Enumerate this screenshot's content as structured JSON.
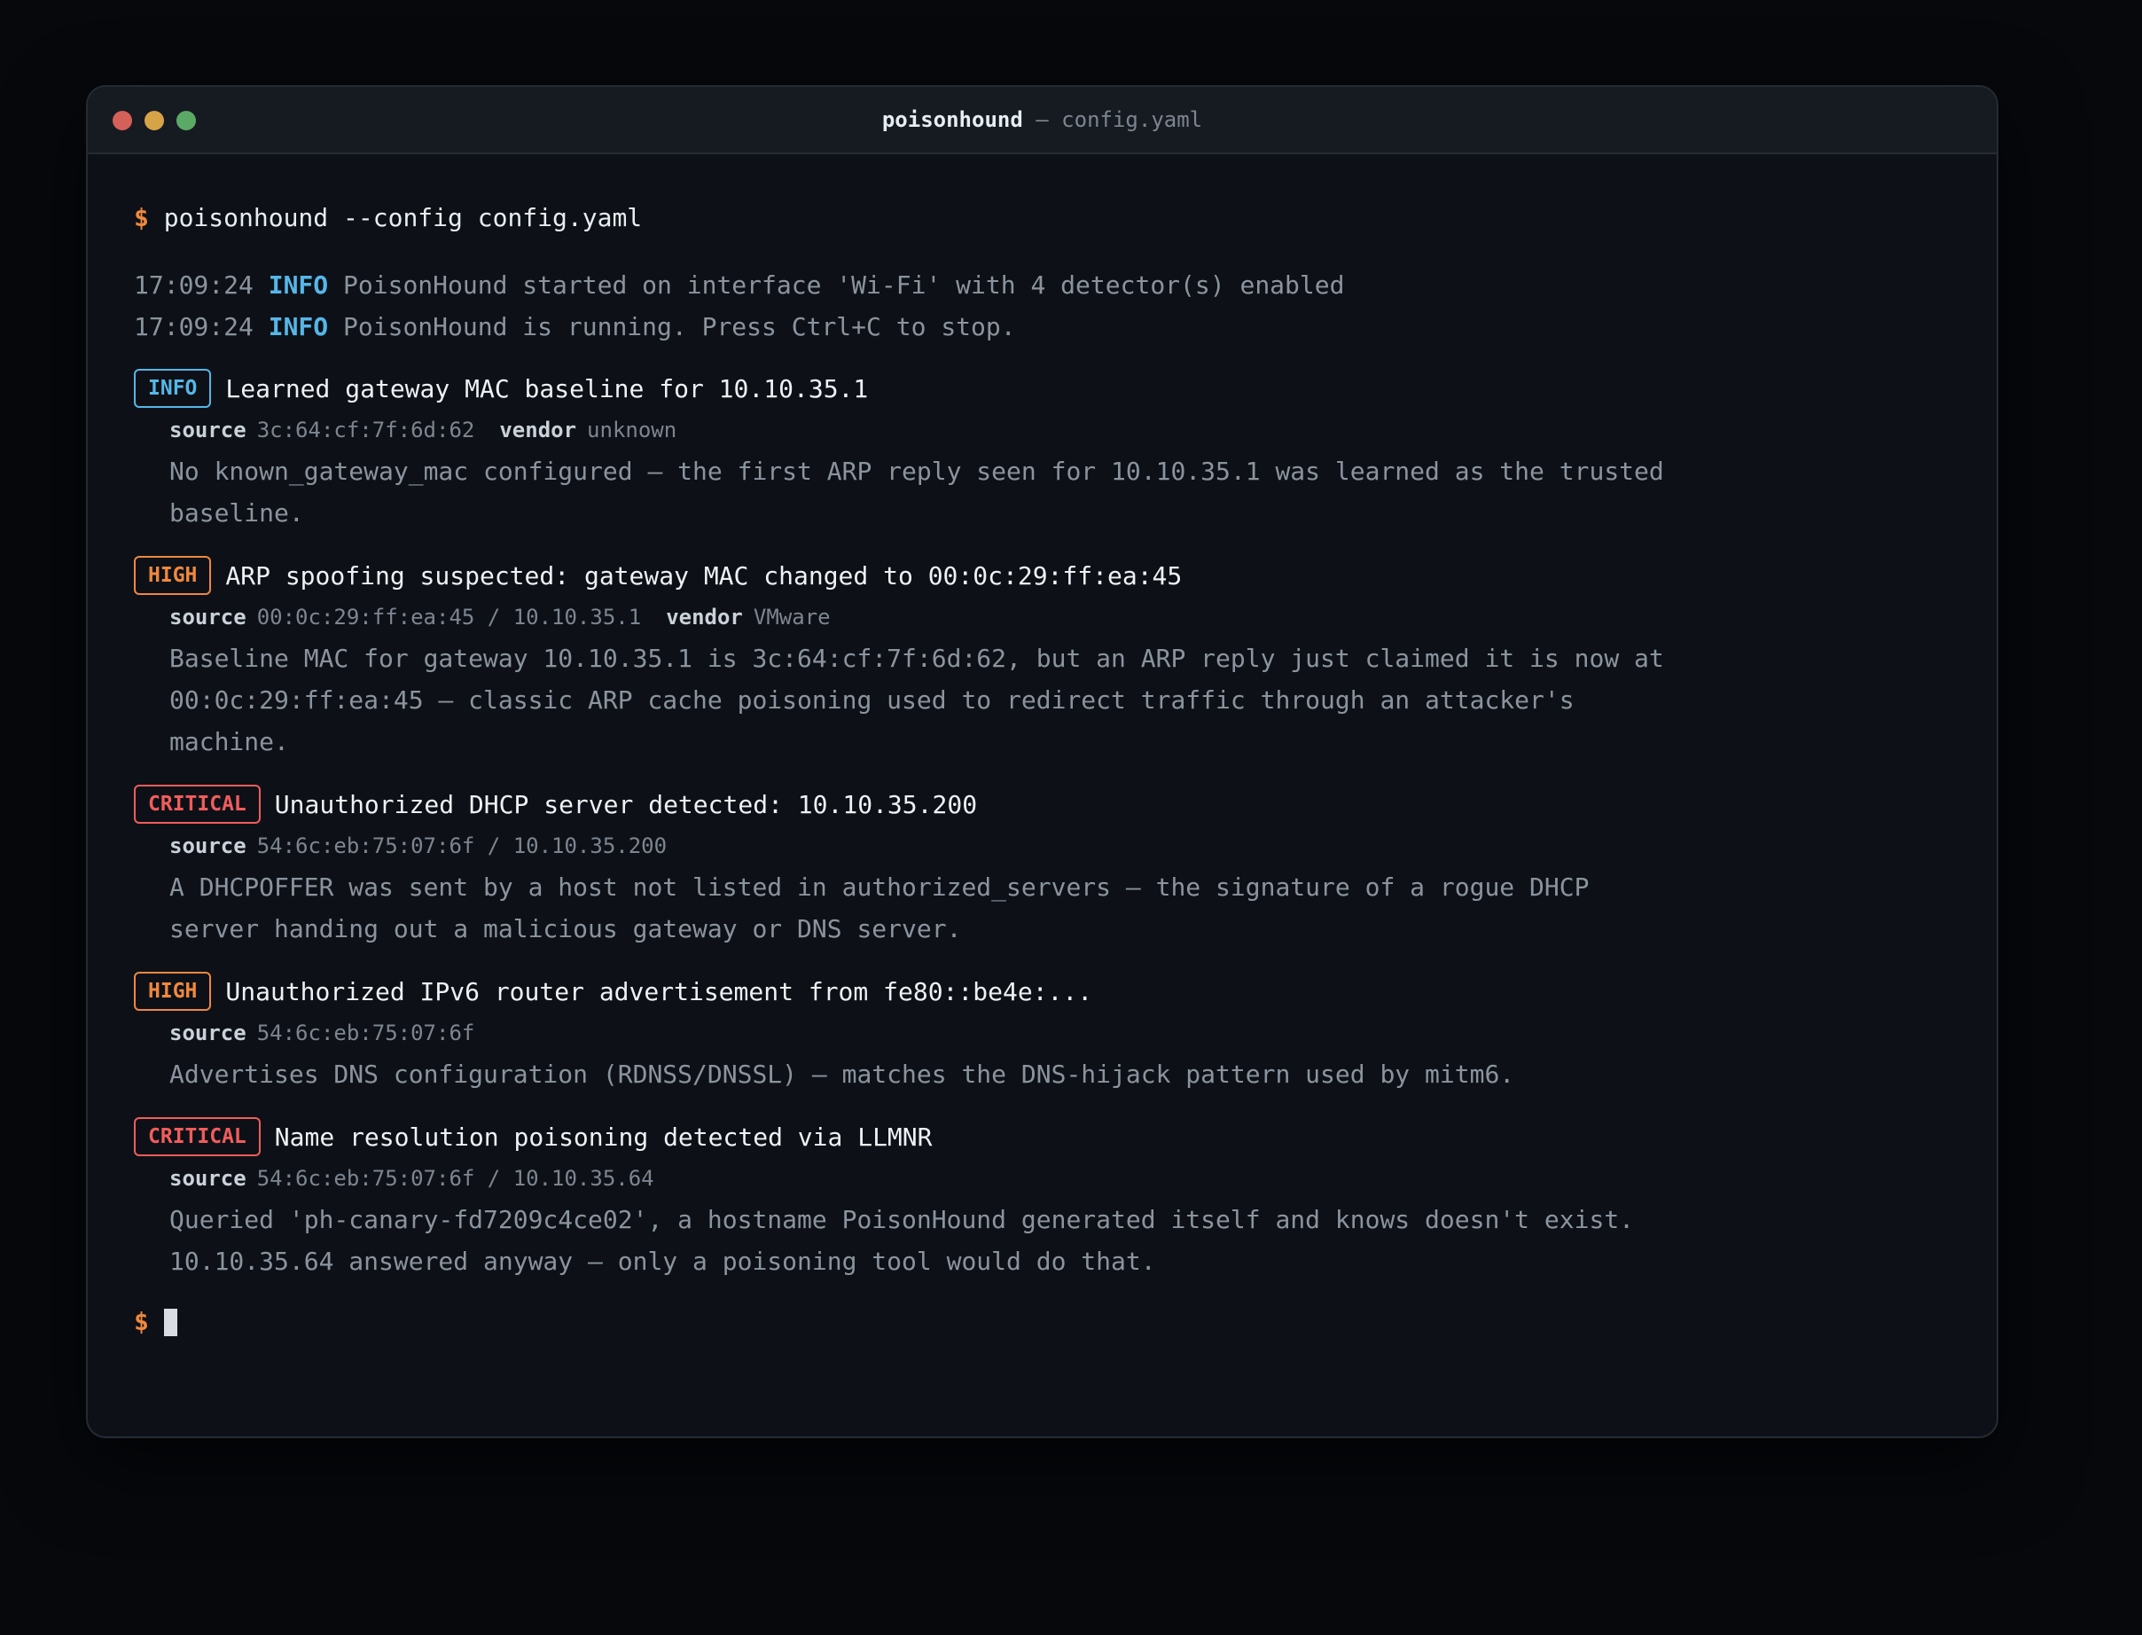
{
  "window": {
    "title_app": "poisonhound",
    "title_sep": " — ",
    "title_file": "config.yaml"
  },
  "command": {
    "prompt": "$",
    "text": "poisonhound --config config.yaml"
  },
  "logs": [
    {
      "time": "17:09:24",
      "level": "INFO",
      "message": "PoisonHound started on interface 'Wi-Fi' with 4 detector(s) enabled"
    },
    {
      "time": "17:09:24",
      "level": "INFO",
      "message": "PoisonHound is running. Press Ctrl+C to stop."
    }
  ],
  "findings": [
    {
      "severity": "INFO",
      "title": "Learned gateway MAC baseline for 10.10.35.1",
      "source_label": "source",
      "source": "3c:64:cf:7f:6d:62",
      "vendor_label": "vendor",
      "vendor": "unknown",
      "description_lines": [
        "No known_gateway_mac configured — the first ARP reply seen for 10.10.35.1 was learned as the trusted",
        "baseline."
      ]
    },
    {
      "severity": "HIGH",
      "title": "ARP spoofing suspected: gateway MAC changed to 00:0c:29:ff:ea:45",
      "source_label": "source",
      "source": "00:0c:29:ff:ea:45 / 10.10.35.1",
      "vendor_label": "vendor",
      "vendor": "VMware",
      "description_lines": [
        "Baseline MAC for gateway 10.10.35.1 is 3c:64:cf:7f:6d:62, but an ARP reply just claimed it is now at",
        "00:0c:29:ff:ea:45 — classic ARP cache poisoning used to redirect traffic through an attacker's",
        "machine."
      ]
    },
    {
      "severity": "CRITICAL",
      "title": "Unauthorized DHCP server detected: 10.10.35.200",
      "source_label": "source",
      "source": "54:6c:eb:75:07:6f / 10.10.35.200",
      "description_lines": [
        "A DHCPOFFER was sent by a host not listed in authorized_servers — the signature of a rogue DHCP",
        "server handing out a malicious gateway or DNS server."
      ]
    },
    {
      "severity": "HIGH",
      "title": "Unauthorized IPv6 router advertisement from fe80::be4e:...",
      "source_label": "source",
      "source": "54:6c:eb:75:07:6f",
      "description_lines": [
        "Advertises DNS configuration (RDNSS/DNSSL) — matches the DNS-hijack pattern used by mitm6."
      ]
    },
    {
      "severity": "CRITICAL",
      "title": "Name resolution poisoning detected via LLMNR",
      "source_label": "source",
      "source": "54:6c:eb:75:07:6f / 10.10.35.64",
      "description_lines": [
        "Queried 'ph-canary-fd7209c4ce02', a hostname PoisonHound generated itself and knows doesn't exist.",
        "10.10.35.64 answered anyway — only a poisoning tool would do that."
      ]
    }
  ],
  "final_prompt": "$",
  "colors": {
    "info": "#56b6e8",
    "high": "#f0883e",
    "critical": "#f25c5c",
    "prompt": "#f0883e"
  }
}
